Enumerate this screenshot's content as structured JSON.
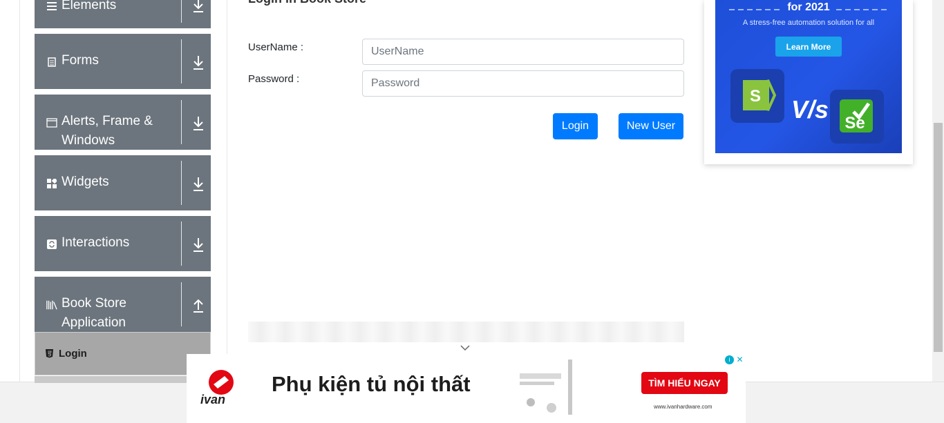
{
  "sidebar": {
    "groups": [
      {
        "label": "Elements",
        "icon": "hamburger-icon",
        "expanded": false
      },
      {
        "label": "Forms",
        "icon": "document-icon",
        "expanded": false
      },
      {
        "label": "Alerts, Frame & Windows",
        "icon": "window-icon",
        "expanded": false
      },
      {
        "label": "Widgets",
        "icon": "widgets-icon",
        "expanded": false
      },
      {
        "label": "Interactions",
        "icon": "refresh-icon",
        "expanded": false
      },
      {
        "label": "Book Store Application",
        "icon": "books-icon",
        "expanded": true
      }
    ],
    "active_item": {
      "label": "Login",
      "icon": "html5-icon"
    }
  },
  "main": {
    "title": "Login in Book Store",
    "fields": [
      {
        "label": "UserName :",
        "placeholder": "UserName",
        "value": ""
      },
      {
        "label": "Password :",
        "placeholder": "Password",
        "value": ""
      }
    ],
    "buttons": {
      "login": "Login",
      "new_user": "New User"
    }
  },
  "side_ad": {
    "headline": "for 2021",
    "subtext": "A stress-free automation solution for all",
    "cta": "Learn More",
    "vs_text": "V/s",
    "logo_left": "S",
    "logo_right": "Se"
  },
  "bottom_ad": {
    "brand": "ivan",
    "headline": "Phụ kiện tủ nội thất",
    "cta": "TÌM HIỂU NGAY",
    "url": "www.ivanhardware.com"
  },
  "colors": {
    "sidebar_group": "#6c757d",
    "sidebar_active": "#a7a7a7",
    "primary_button": "#007bff",
    "ad_blue": "#2456e6",
    "ad_red": "#e30613"
  }
}
